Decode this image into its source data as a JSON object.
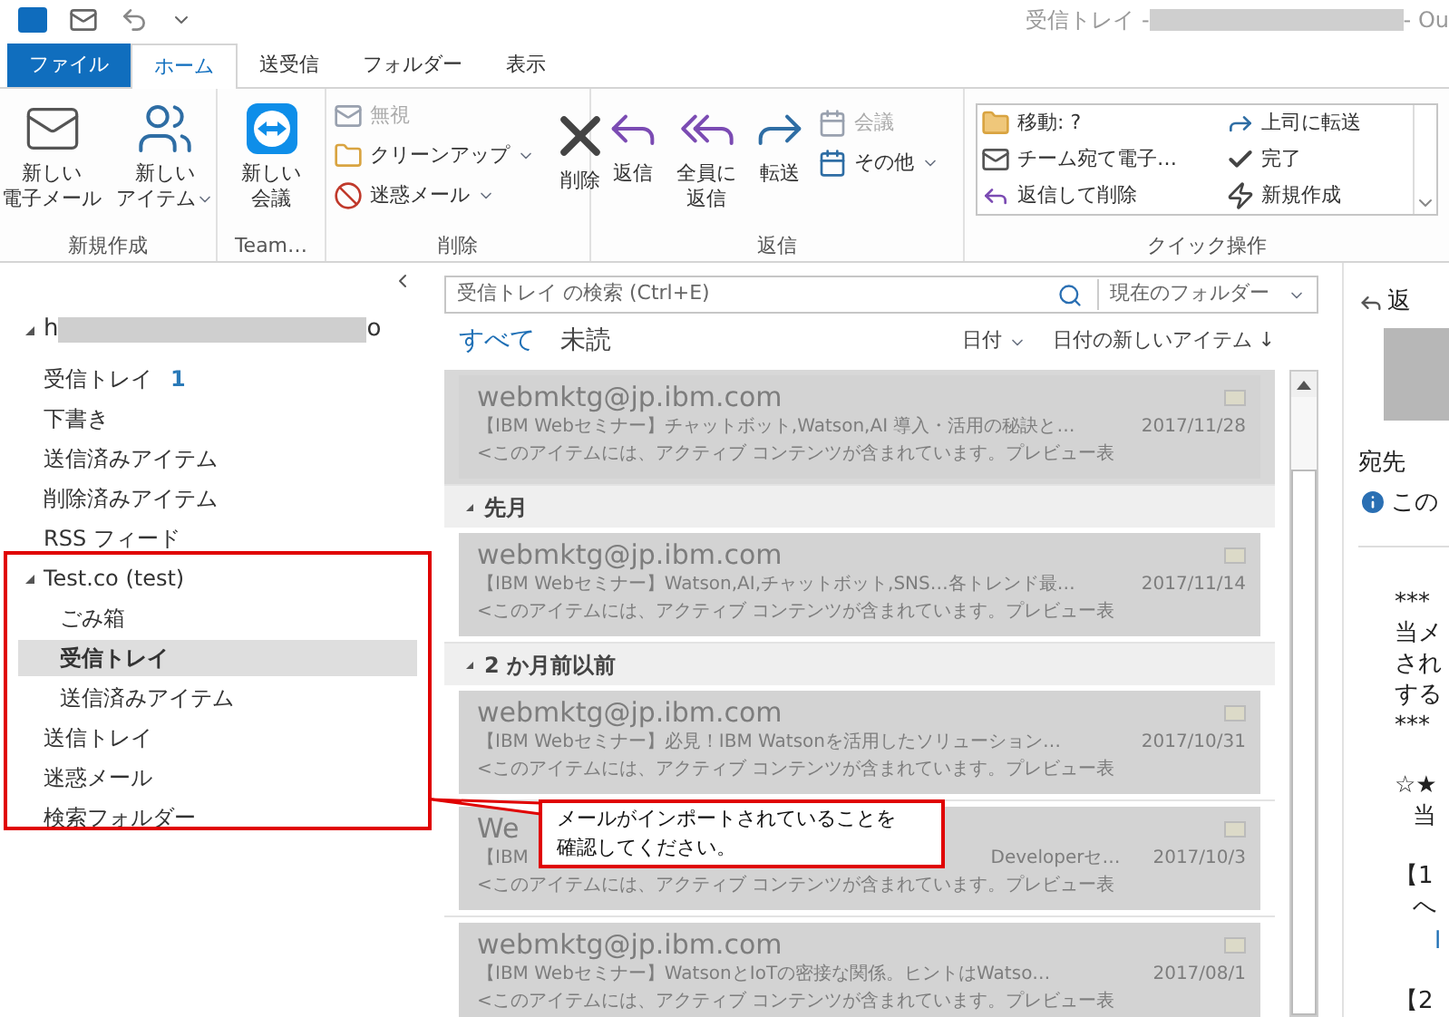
{
  "window": {
    "title_start": "受信トレイ - ",
    "title_end": " - Ou"
  },
  "ribbon_tabs": [
    {
      "label": "ファイル",
      "kind": "file",
      "selected": false
    },
    {
      "label": "ホーム",
      "kind": "tab",
      "selected": true
    },
    {
      "label": "送受信",
      "kind": "tab",
      "selected": false
    },
    {
      "label": "フォルダー",
      "kind": "tab",
      "selected": false
    },
    {
      "label": "表示",
      "kind": "tab",
      "selected": false
    }
  ],
  "ribbon": {
    "new_group": {
      "label": "新規作成",
      "buttons": [
        {
          "lines": [
            "新しい",
            "電子メール"
          ],
          "dropdown": false
        },
        {
          "lines": [
            "新しい",
            "アイテム"
          ],
          "dropdown": true
        }
      ]
    },
    "team_group": {
      "label": "Team…",
      "buttons": [
        {
          "lines": [
            "新しい",
            "会議"
          ],
          "dropdown": false
        }
      ]
    },
    "delete_group": {
      "label": "削除",
      "small": [
        {
          "label": "無視",
          "disabled": true,
          "dropdown": false
        },
        {
          "label": "クリーンアップ",
          "disabled": false,
          "dropdown": true
        },
        {
          "label": "迷惑メール",
          "disabled": false,
          "dropdown": true
        }
      ],
      "large": {
        "lines": [
          "削除"
        ],
        "dropdown": false
      }
    },
    "reply_group": {
      "label": "返信",
      "buttons": [
        {
          "lines": [
            "返信"
          ],
          "dropdown": false
        },
        {
          "lines": [
            "全員に",
            "返信"
          ],
          "dropdown": false
        },
        {
          "lines": [
            "転送"
          ],
          "dropdown": false
        }
      ],
      "small": [
        {
          "label": "会議",
          "disabled": true,
          "dropdown": false
        },
        {
          "label": "その他",
          "disabled": false,
          "dropdown": true
        }
      ]
    },
    "quick_group": {
      "label": "クイック操作",
      "items": [
        "移動: ?",
        "チーム宛て電子…",
        "返信して削除",
        "上司に転送",
        "完了",
        "新規作成"
      ]
    }
  },
  "folder_pane": {
    "account": {
      "prefix": "h",
      "suffix": "o",
      "expanded": true,
      "children": [
        {
          "label": "受信トレイ",
          "count": "1",
          "selected": false
        },
        {
          "label": "下書き",
          "selected": false
        },
        {
          "label": "送信済みアイテム",
          "selected": false
        },
        {
          "label": "削除済みアイテム",
          "selected": false
        },
        {
          "label": "RSS フィード",
          "selected": false
        },
        {
          "label": "Test.co (test)",
          "selected": false,
          "expanded": true,
          "children": [
            {
              "label": "ごみ箱",
              "selected": false
            },
            {
              "label": "受信トレイ",
              "selected": true
            },
            {
              "label": "送信済みアイテム",
              "selected": false
            }
          ]
        },
        {
          "label": "送信トレイ",
          "selected": false
        },
        {
          "label": "迷惑メール",
          "selected": false
        },
        {
          "label": "検索フォルダー",
          "selected": false
        }
      ]
    }
  },
  "message_list": {
    "search_placeholder": "受信トレイ の検索 (Ctrl+E)",
    "scope": "現在のフォルダー",
    "filters": [
      {
        "label": "すべて",
        "selected": true
      },
      {
        "label": "未読",
        "selected": false
      }
    ],
    "sort": "日付",
    "order": "日付の新しいアイテム ↓",
    "items": [
      {
        "kind": "message",
        "sender": "webmktg@jp.ibm.com",
        "subject": "【IBM Webセミナー】チャットボット,Watson,AI 導入・活用の秘訣と…",
        "date": "2017/11/28",
        "preview": "<このアイテムには、アクティブ コンテンツが含まれています。プレビュー表",
        "selected": true
      },
      {
        "kind": "group",
        "label": "先月"
      },
      {
        "kind": "message",
        "sender": "webmktg@jp.ibm.com",
        "subject": "【IBM Webセミナー】Watson,AI,チャットボット,SNS…各トレンド最…",
        "date": "2017/11/14",
        "preview": "<このアイテムには、アクティブ コンテンツが含まれています。プレビュー表",
        "selected": false
      },
      {
        "kind": "group",
        "label": "2 か月前以前"
      },
      {
        "kind": "message",
        "sender": "webmktg@jp.ibm.com",
        "subject": "【IBM Webセミナー】必見！IBM Watsonを活用したソリューション…",
        "date": "2017/10/31",
        "preview": "<このアイテムには、アクティブ コンテンツが含まれています。プレビュー表",
        "selected": false
      },
      {
        "kind": "covered",
        "sender": "We",
        "subject_start": "【IBM",
        "subject_end": "Developerセ…",
        "date": "2017/10/3",
        "preview": "<このアイテムには、アクティブ コンテンツが含まれています。プレビュー表",
        "selected": false
      },
      {
        "kind": "message",
        "sender": "webmktg@jp.ibm.com",
        "subject": "【IBM Webセミナー】WatsonとIoTの密接な関係。ヒントはWatso…",
        "date": "2017/08/1",
        "preview": "<このアイテムには、アクティブ コンテンツが含まれています。プレビュー表",
        "selected": false
      }
    ]
  },
  "reading_pane": {
    "reply": "返",
    "to_label": "宛先",
    "info": "この",
    "lines": [
      {
        "text": "***",
        "kind": "text"
      },
      {
        "text": "当メ",
        "kind": "text"
      },
      {
        "text": "され",
        "kind": "text"
      },
      {
        "text": "する",
        "kind": "text"
      },
      {
        "text": "***",
        "kind": "text"
      },
      {
        "text": "☆★",
        "kind": "gap"
      },
      {
        "text": "当",
        "kind": "indent"
      },
      {
        "text": "【1",
        "kind": "gap"
      },
      {
        "text": "へ",
        "kind": "indent"
      },
      {
        "text": "l",
        "kind": "link"
      },
      {
        "text": "【2",
        "kind": "gap"
      }
    ]
  },
  "callout": {
    "lines": [
      "メールがインポートされていることを",
      "確認してください。"
    ]
  }
}
